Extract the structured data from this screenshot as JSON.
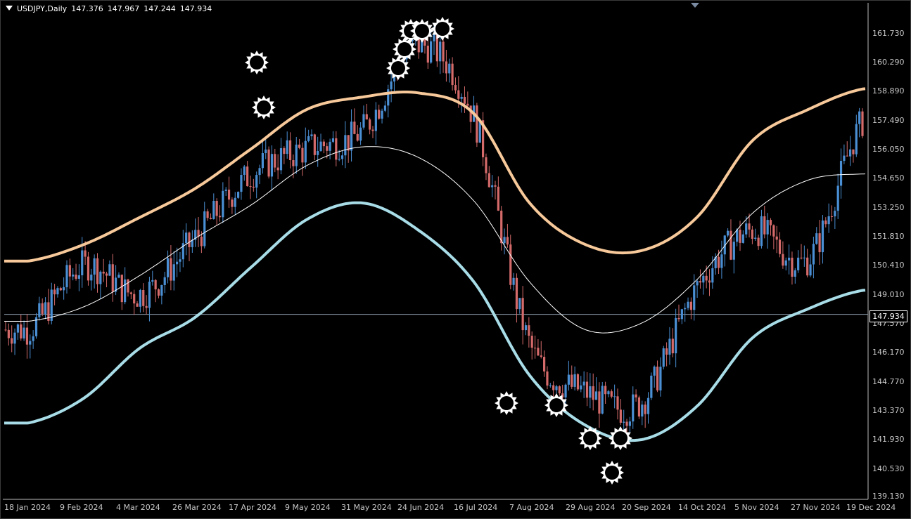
{
  "header": {
    "symbol": "USDJPY,Daily",
    "open": "147.376",
    "high": "147.967",
    "low": "147.244",
    "close": "147.934"
  },
  "price_axis": [
    "161.730",
    "160.290",
    "158.890",
    "157.490",
    "156.050",
    "154.650",
    "153.250",
    "151.810",
    "150.410",
    "149.010",
    "147.570",
    "146.170",
    "144.770",
    "143.370",
    "141.930",
    "140.530",
    "139.130"
  ],
  "current_price": "147.934",
  "date_axis": [
    "18 Jan 2024",
    "9 Feb 2024",
    "4 Mar 2024",
    "26 Mar 2024",
    "17 Apr 2024",
    "9 May 2024",
    "31 May 2024",
    "24 Jun 2024",
    "16 Jul 2024",
    "7 Aug 2024",
    "29 Aug 2024",
    "20 Sep 2024",
    "14 Oct 2024",
    "5 Nov 2024",
    "27 Nov 2024",
    "19 Dec 2024"
  ],
  "colors": {
    "background": "#000000",
    "bull": "#4a8fd4",
    "bear": "#d46a6a",
    "upper_band": "#f7c99a",
    "lower_band": "#a8dde8",
    "middle_line": "#ffffff",
    "text": "#c8c8c8"
  },
  "chart_data": {
    "type": "line",
    "title": "USDJPY,Daily",
    "x": [
      "18 Jan",
      "9 Feb",
      "4 Mar",
      "26 Mar",
      "17 Apr",
      "9 May",
      "31 May",
      "24 Jun",
      "16 Jul",
      "7 Aug",
      "29 Aug",
      "20 Sep",
      "14 Oct",
      "5 Nov",
      "27 Nov",
      "19 Dec"
    ],
    "series": [
      {
        "values": [
          147.6,
          148.3,
          149.8,
          151.6,
          153.2,
          155.1,
          156.0,
          155.5,
          153.4,
          149.5,
          147.2,
          147.5,
          149.6,
          152.8,
          154.4,
          154.7
        ]
      },
      {
        "values": [
          150.5,
          151.3,
          152.6,
          154.0,
          155.9,
          157.8,
          158.4,
          158.6,
          157.6,
          153.3,
          151.3,
          151.0,
          152.6,
          156.3,
          157.8,
          158.8
        ]
      },
      {
        "values": [
          142.7,
          143.9,
          146.3,
          147.8,
          150.2,
          152.5,
          153.3,
          152.0,
          149.5,
          145.0,
          142.6,
          141.9,
          143.5,
          146.8,
          148.2,
          149.1
        ]
      },
      {
        "values": [
          147.2,
          150.3,
          148.9,
          151.6,
          154.7,
          155.9,
          156.8,
          160.9,
          157.4,
          146.5,
          144.2,
          143.7,
          149.2,
          152.0,
          150.6,
          157.3
        ]
      }
    ],
    "ylim": [
      139.13,
      162.6
    ],
    "markers_high": [
      "17 Apr",
      "19 Apr",
      "19 Jun",
      "21 Jun",
      "25 Jun",
      "27 Jun",
      "29 Jun",
      "3 Jul"
    ],
    "markers_low": [
      "5 Aug",
      "19 Aug",
      "3 Sep",
      "10 Sep",
      "14 Sep"
    ]
  }
}
